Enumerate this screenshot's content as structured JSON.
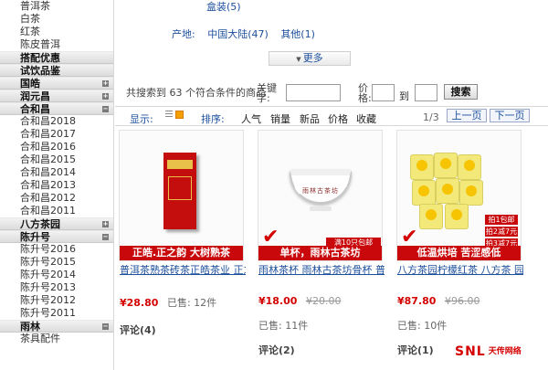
{
  "sidebar": {
    "top_links": [
      "普洱茶",
      "白茶",
      "红茶",
      "陈皮普洱"
    ],
    "groups": [
      {
        "title": "搭配优惠",
        "links": []
      },
      {
        "title": "试饮品鉴",
        "links": []
      },
      {
        "title": "国皓",
        "links": []
      },
      {
        "title": "润元昌",
        "links": []
      },
      {
        "title": "合和昌",
        "links": [
          "合和昌2018",
          "合和昌2017",
          "合和昌2016",
          "合和昌2015",
          "合和昌2014",
          "合和昌2013",
          "合和昌2012",
          "合和昌2011"
        ]
      },
      {
        "title": "八方茶园",
        "links": []
      },
      {
        "title": "陈升号",
        "links": [
          "陈升号2016",
          "陈升号2015",
          "陈升号2014",
          "陈升号2013",
          "陈升号2012",
          "陈升号2011"
        ]
      },
      {
        "title": "雨林",
        "links": [
          "茶具配件"
        ]
      }
    ]
  },
  "filter": {
    "prev_item": "盒装(5)",
    "origin_label": "产地:",
    "origin_options": [
      "中国大陆(47)",
      "其他(1)"
    ],
    "more_label": "更多"
  },
  "search": {
    "result_text": "共搜索到 63 个符合条件的商品",
    "keyword_label": "关键字:",
    "price_label": "价格:",
    "to_label": "到",
    "button_label": "搜索"
  },
  "sort_bar": {
    "view_label": "显示:",
    "sort_label": "排序:",
    "options": [
      "人气",
      "销量",
      "新品",
      "价格",
      "收藏"
    ],
    "page_count": "1/3",
    "prev_page": "上一页",
    "next_page": "下一页"
  },
  "products": [
    {
      "banner": "正皓.正之韵 大树熟茶",
      "title": "普洱茶熟茶砖茶正皓茶业 正之韵普洱金砖茶砖古树",
      "price": "¥28.80",
      "old_price": "",
      "sold": "已售: 12件",
      "comments": "评论(4)"
    },
    {
      "banner": "单杯，雨林古茶坊",
      "promo": "满10只包邮",
      "title": "雨林茶杯 雨林古茶坊骨杯 普洱品茶杯雨林杯子精品",
      "price": "¥18.00",
      "old_price": "¥20.00",
      "sold": "已售: 11件",
      "comments": "评论(2)"
    },
    {
      "banner": "低温烘培 苦涩感低",
      "promos": [
        "拍1包邮",
        "拍2减7元",
        "拍3减7元"
      ],
      "title": "八方茶园柠檬红茶 八方茶 园心香柠 柠檬红茶 香柠红",
      "price": "¥87.80",
      "old_price": "¥96.00",
      "sold": "已售: 10件",
      "comments": "评论(1)"
    }
  ],
  "watermark": {
    "logo": "SNL",
    "brand": "天传网络"
  },
  "colors": {
    "link": "#1c4f9c",
    "price": "#d40000",
    "banner": "#c8080b"
  }
}
